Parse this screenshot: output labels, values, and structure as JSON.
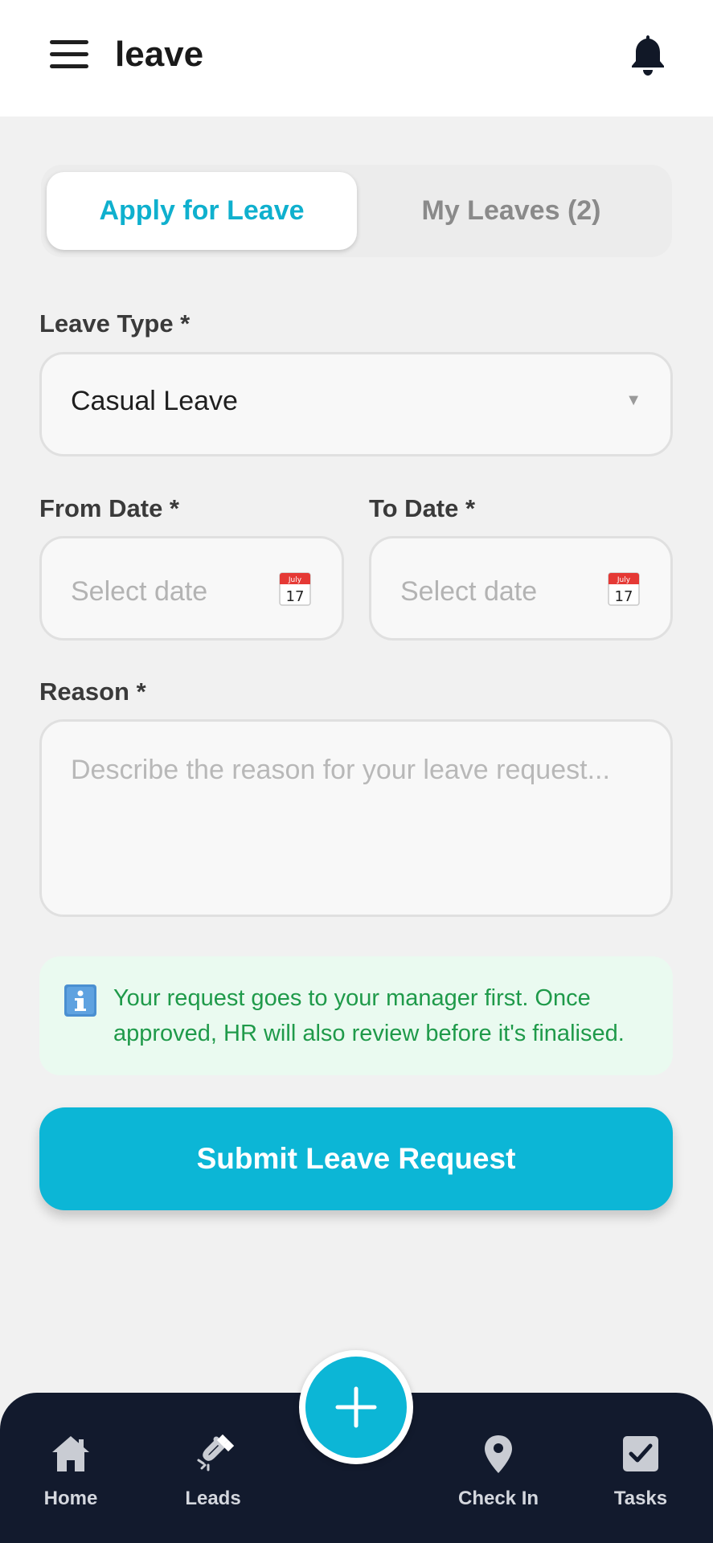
{
  "header": {
    "title": "leave"
  },
  "tabs": [
    {
      "label": "Apply for Leave",
      "active": true
    },
    {
      "label": "My Leaves (2)",
      "active": false
    }
  ],
  "form": {
    "leave_type_label": "Leave Type *",
    "leave_type_value": "Casual Leave",
    "from_date_label": "From Date *",
    "from_date_placeholder": "Select date",
    "to_date_label": "To Date *",
    "to_date_placeholder": "Select date",
    "calendar_icon_month": "July",
    "calendar_icon_day": "17",
    "reason_label": "Reason *",
    "reason_placeholder": "Describe the reason for your leave request..."
  },
  "info": {
    "line1": "Your request goes to your manager first. Once",
    "line2": "approved, HR will also review before it's finalised."
  },
  "submit_label": "Submit Leave Request",
  "bottom_nav": {
    "items": [
      {
        "label": "Home",
        "icon": "home-icon"
      },
      {
        "label": "Leads",
        "icon": "magnet-icon"
      },
      {
        "label": "Check In",
        "icon": "location-pin-icon"
      },
      {
        "label": "Tasks",
        "icon": "checkbox-icon"
      }
    ],
    "fab_icon": "plus-icon"
  },
  "colors": {
    "accent": "#0cb6d6",
    "nav_background": "#121a2d",
    "info_background": "#eafaf0",
    "info_text": "#1f9a4a"
  }
}
